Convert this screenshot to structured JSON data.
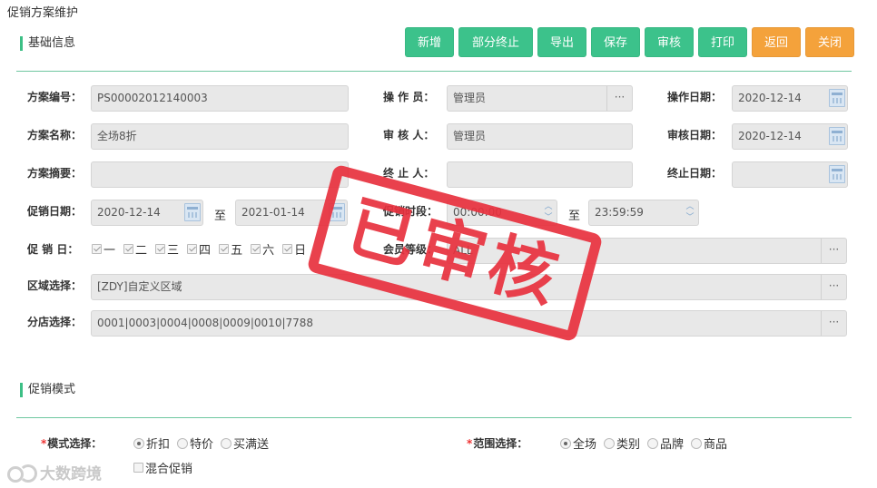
{
  "page": {
    "title": "促销方案维护"
  },
  "toolbar": {
    "buttons": [
      {
        "label": "新增",
        "color": "#3cc28b"
      },
      {
        "label": "部分终止",
        "color": "#3cc28b"
      },
      {
        "label": "导出",
        "color": "#3cc28b"
      },
      {
        "label": "保存",
        "color": "#3cc28b"
      },
      {
        "label": "审核",
        "color": "#3cc28b"
      },
      {
        "label": "打印",
        "color": "#3cc28b"
      },
      {
        "label": "返回",
        "color": "#f4a23b"
      },
      {
        "label": "关闭",
        "color": "#f4a23b"
      }
    ]
  },
  "basic": {
    "heading": "基础信息",
    "plan_no_label": "方案编号：",
    "plan_no": "PS00002012140003",
    "operator_label": "操 作 员：",
    "operator": "管理员",
    "op_date_label": "操作日期：",
    "op_date": "2020-12-14",
    "plan_name_label": "方案名称：",
    "plan_name": "全场8折",
    "reviewer_label": "审 核 人：",
    "reviewer": "管理员",
    "review_date_label": "审核日期：",
    "review_date": "2020-12-14",
    "summary_label": "方案摘要：",
    "summary": "",
    "terminator_label": "终 止 人：",
    "terminator": "",
    "end_date_label": "终止日期：",
    "end_date": "",
    "promo_date_label": "促销日期：",
    "promo_start": "2020-12-14",
    "to_label": "至",
    "promo_end": "2021-01-14",
    "promo_time_label": "促销时段：",
    "time_start": "00:00:00",
    "time_end": "23:59:59",
    "promo_day_label": "促 销 日：",
    "weekdays": [
      "一",
      "二",
      "三",
      "四",
      "五",
      "六",
      "日"
    ],
    "member_level_label": "会员等级：",
    "member_level": "ALL",
    "region_label": "区域选择：",
    "region": "[ZDY]自定义区域",
    "branch_label": "分店选择：",
    "branch": "0001|0003|0004|0008|0009|0010|7788"
  },
  "mode": {
    "heading": "促销模式",
    "mode_label": "模式选择：",
    "mode_options": [
      "折扣",
      "特价",
      "买满送"
    ],
    "mode_selected": "折扣",
    "mixed_label": "混合促销",
    "scope_label": "范围选择：",
    "scope_options": [
      "全场",
      "类别",
      "品牌",
      "商品"
    ],
    "scope_selected": "全场"
  },
  "stamp": {
    "text": "已审核",
    "color": "#e8313e"
  },
  "watermark": {
    "text": "大数跨境"
  },
  "icons": {
    "more": "ellipsis-icon",
    "calendar": "calendar-icon",
    "spinner": "spinner-icon"
  }
}
